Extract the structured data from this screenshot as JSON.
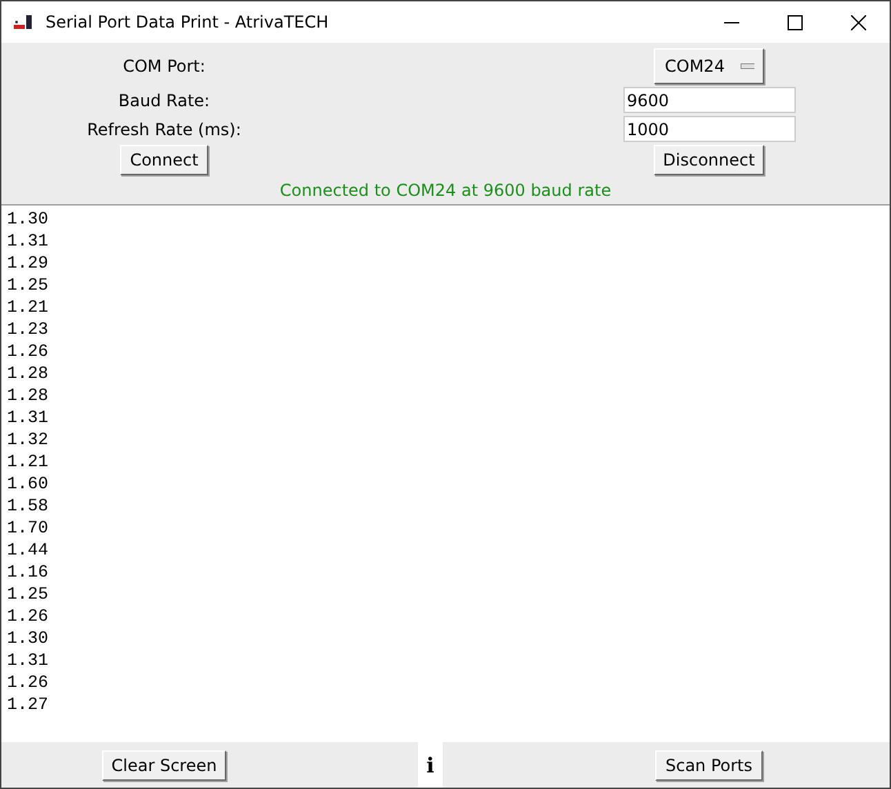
{
  "window": {
    "title": "Serial Port Data Print - AtrivaTECH"
  },
  "settings": {
    "com_port_label": "COM Port:",
    "com_port_value": "COM24",
    "baud_rate_label": "Baud Rate:",
    "baud_rate_value": "9600",
    "refresh_rate_label": "Refresh Rate (ms):",
    "refresh_rate_value": "1000"
  },
  "buttons": {
    "connect": "Connect",
    "disconnect": "Disconnect",
    "clear": "Clear Screen",
    "scan": "Scan Ports",
    "info": "i"
  },
  "status": "Connected to COM24 at 9600 baud rate",
  "output_lines": [
    "1.30",
    "1.31",
    "1.29",
    "1.25",
    "1.21",
    "1.23",
    "1.26",
    "1.28",
    "1.28",
    "1.31",
    "1.32",
    "1.21",
    "1.60",
    "1.58",
    "1.70",
    "1.44",
    "1.16",
    "1.25",
    "1.26",
    "1.30",
    "1.31",
    "1.26",
    "1.27"
  ]
}
